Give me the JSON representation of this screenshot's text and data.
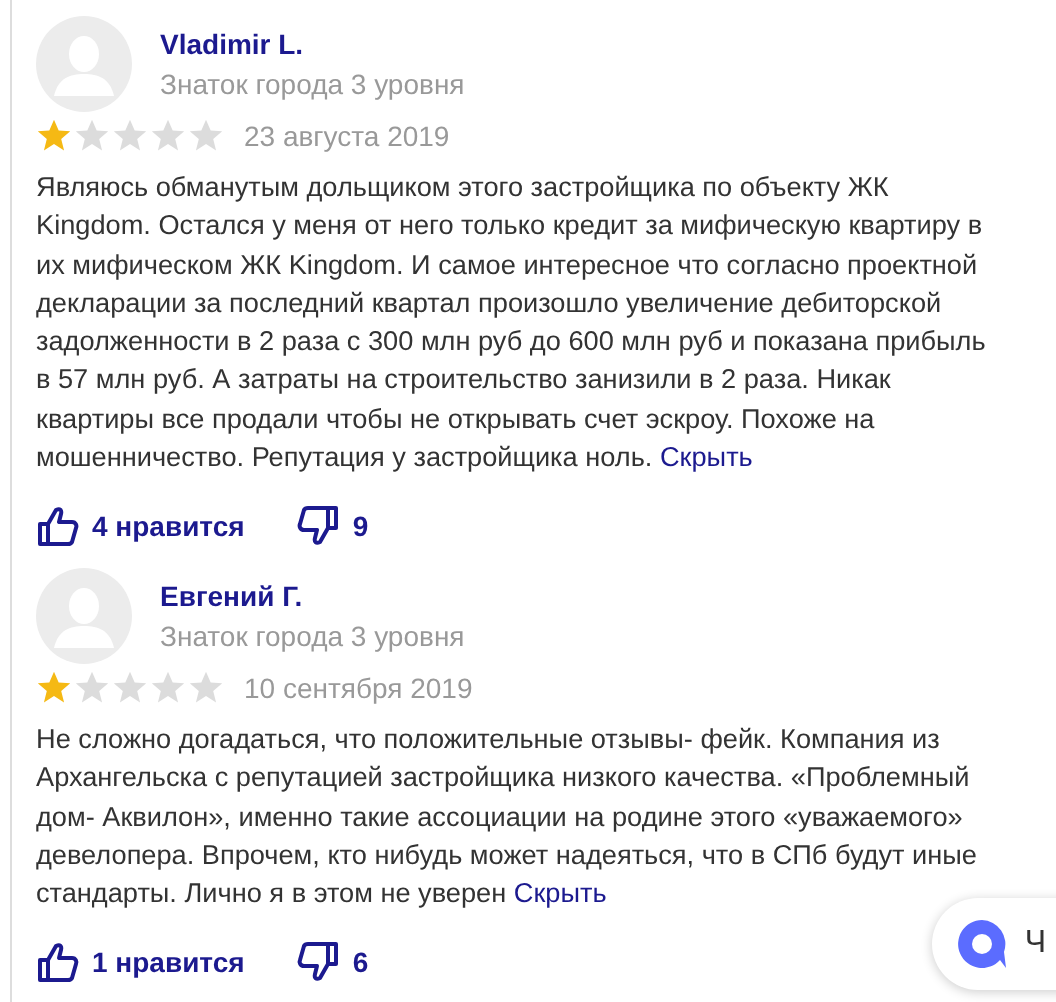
{
  "reviews": [
    {
      "author": "Vladimir L.",
      "rank": "Знаток города 3 уровня",
      "stars": 1,
      "date": "23 августа 2019",
      "text": "Являюсь обманутым дольщиком этого застройщика по объекту ЖК Kingdom. Остался у меня от него только кредит за мифическую квартиру в их мифическом ЖК Kingdom. И самое интересное что согласно проектной декларации за последний квартал произошло увеличение дебиторской задолженности в 2 раза с 300 млн руб до 600 млн руб и показана прибыль в 57 млн руб. А затраты на строительство занизили в 2 раза. Никак квартиры все продали чтобы не открывать счет эскроу. Похоже на мошенничество. Репутация у застройщика ноль.",
      "hide_link": "Скрыть",
      "likes": "4 нравится",
      "dislikes": "9"
    },
    {
      "author": "Евгений Г.",
      "rank": "Знаток города 3 уровня",
      "stars": 1,
      "date": "10 сентября 2019",
      "text": "Не сложно догадаться, что положительные отзывы- фейк. Компания из Архангельска с репутацией застройщика низкого качества. «Проблемный дом- Аквилон», именно такие ассоциации на родине этого «уважаемого» девелопера. Впрочем, кто нибудь может надеяться, что в СПб будут иные стандарты. Лично я в этом не уверен",
      "hide_link": "Скрыть",
      "likes": "1 нравится",
      "dislikes": "6"
    }
  ],
  "chat_button": {
    "label": "Ч"
  }
}
